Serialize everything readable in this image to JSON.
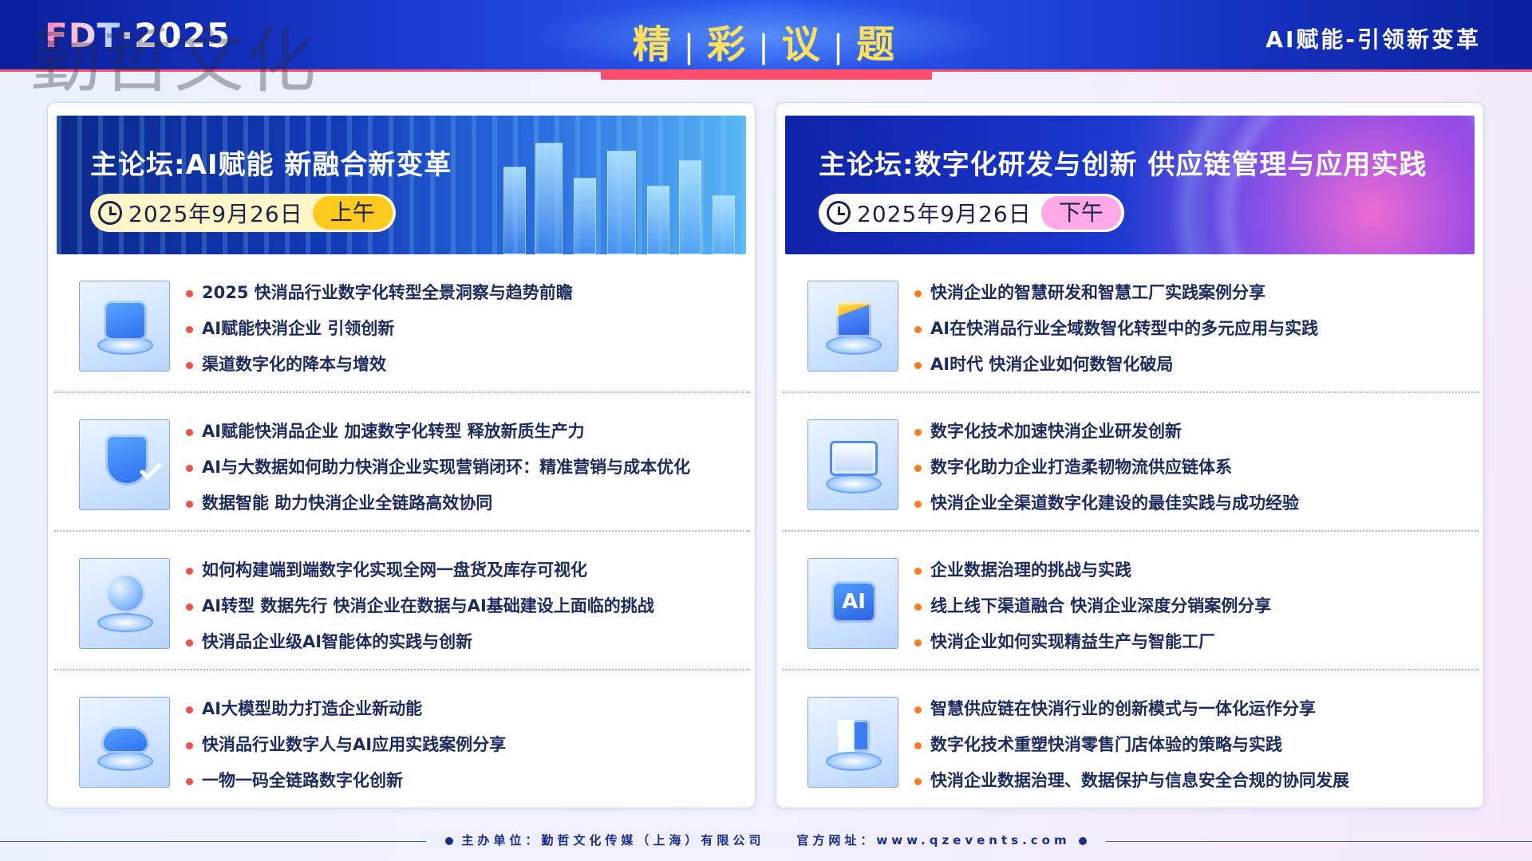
{
  "header": {
    "brand_prefix": "FDT",
    "brand_dot": "·",
    "brand_year": "2025",
    "watermark": "勤哲文化",
    "title_chars": [
      "精",
      "彩",
      "议",
      "题"
    ],
    "title_sep": "|",
    "slogan": "AI赋能-引领新变革"
  },
  "left": {
    "banner_title": "主论坛:AI赋能 新融合新变革",
    "date": "2025年9月26日",
    "period": "上午",
    "sections": [
      {
        "icon": "chart-device-icon",
        "items": [
          "2025 快消品行业数字化转型全景洞察与趋势前瞻",
          "AI赋能快消企业 引领创新",
          "渠道数字化的降本与增效"
        ]
      },
      {
        "icon": "shield-check-icon",
        "items": [
          "AI赋能快消品企业 加速数字化转型 释放新质生产力",
          "AI与大数据如何助力快消企业实现营销闭环：精准营销与成本优化",
          "数据智能 助力快消企业全链路高效协同"
        ]
      },
      {
        "icon": "globe-icon",
        "items": [
          "如何构建端到端数字化实现全网一盘货及库存可视化",
          "AI转型 数据先行 快消企业在数据与AI基础建设上面临的挑战",
          "快消品企业级AI智能体的实践与创新"
        ]
      },
      {
        "icon": "cloud-icon",
        "items": [
          "AI大模型助力打造企业新动能",
          "快消品行业数字人与AI应用实践案例分享",
          "一物一码全链路数字化创新"
        ]
      }
    ]
  },
  "right": {
    "banner_title": "主论坛:数字化研发与创新 供应链管理与应用实践",
    "date": "2025年9月26日",
    "period": "下午",
    "sections": [
      {
        "icon": "cube-icon",
        "items": [
          "快消企业的智慧研发和智慧工厂实践案例分享",
          "AI在快消品行业全域数智化转型中的多元应用与实践",
          "AI时代 快消企业如何数智化破局"
        ]
      },
      {
        "icon": "analytics-screen-icon",
        "items": [
          "数字化技术加速快消企业研发创新",
          "数字化助力企业打造柔韧物流供应链体系",
          "快消企业全渠道数字化建设的最佳实践与成功经验"
        ]
      },
      {
        "icon": "ai-chip-icon",
        "ai_text": "AI",
        "items": [
          "企业数据治理的挑战与实践",
          "线上线下渠道融合 快消企业深度分销案例分享",
          "快消企业如何实现精益生产与智能工厂"
        ]
      },
      {
        "icon": "blocks-icon",
        "items": [
          "智慧供应链在快消行业的创新模式与一体化运作分享",
          "数字化技术重塑快消零售门店体验的策略与实践",
          "快消企业数据治理、数据保护与信息安全合规的协同发展"
        ]
      }
    ]
  },
  "footer": {
    "organizer": "主办单位：勤哲文化传媒（上海）有限公司",
    "website": "官方网址：www.qzevents.com"
  },
  "colors": {
    "header_blue": "#1c3fd6",
    "title_yellow": "#ffe25a",
    "accent_red": "#ff4d6d",
    "am_pill": "#ffca1e",
    "pm_pill": "#ffa8e6",
    "bullet_left": "#f0504a",
    "bullet_right": "#ff7a1a"
  }
}
